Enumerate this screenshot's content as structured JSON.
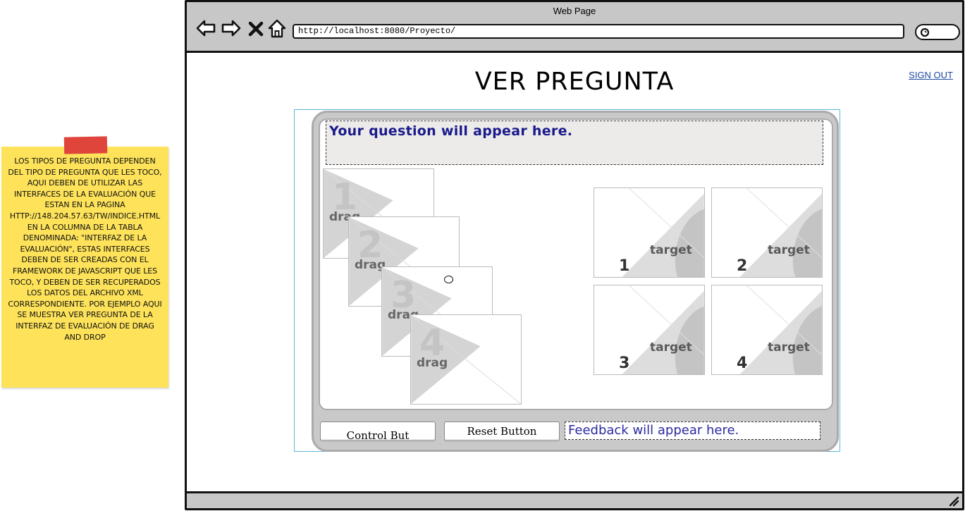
{
  "sticky_note": {
    "text": "LOS TIPOS DE PREGUNTA DEPENDEN DEL TIPO DE PREGUNTA QUE LES TOCO, AQUI DEBEN DE UTILIZAR LAS INTERFACES DE LA EVALUACIÓN QUE ESTAN EN LA PAGINA http://148.204.57.63/TW/indice.html EN LA COLUMNA DE LA TABLA DENOMINADA: \"INTERFAZ DE LA EVALUACIÓN\", ESTAS INTERFACES DEBEN DE SER CREADAS CON EL FRAMEWORK DE JAVASCRIPT QUE LES TOCO, Y DEBEN DE SER RECUPERADOS LOS DATOS DEL ARCHIVO XML CORRESPONDIENTE. POR EJEMPLO AQUI SE MUESTRA VER PREGUNTA DE LA INTERFAZ DE EVALUACIÓN DE DRAG AND DROP",
    "tape_color": "#e0453c",
    "note_color": "#fde25a"
  },
  "browser": {
    "title": "Web Page",
    "url": "http://localhost:8080/Proyecto/",
    "icons": [
      "back-arrow-icon",
      "forward-arrow-icon",
      "close-x-icon",
      "home-icon",
      "search-icon"
    ]
  },
  "page": {
    "heading": "VER PREGUNTA",
    "sign_out": "SIGN OUT",
    "link_color": "#1c4aa3"
  },
  "activity": {
    "question": "Your question will appear here.",
    "feedback": "Feedback will appear here.",
    "control_button": "Control But",
    "reset_button": "Reset Button",
    "drag_items": [
      {
        "number": "1",
        "label": "drag"
      },
      {
        "number": "2",
        "label": "drag"
      },
      {
        "number": "3",
        "label": "drag"
      },
      {
        "number": "4",
        "label": "drag"
      }
    ],
    "targets": [
      {
        "number": "1",
        "label": "target"
      },
      {
        "number": "2",
        "label": "target"
      },
      {
        "number": "3",
        "label": "target"
      },
      {
        "number": "4",
        "label": "target"
      }
    ],
    "question_color": "#1a1a8c",
    "feedback_color": "#2b2ba3"
  }
}
